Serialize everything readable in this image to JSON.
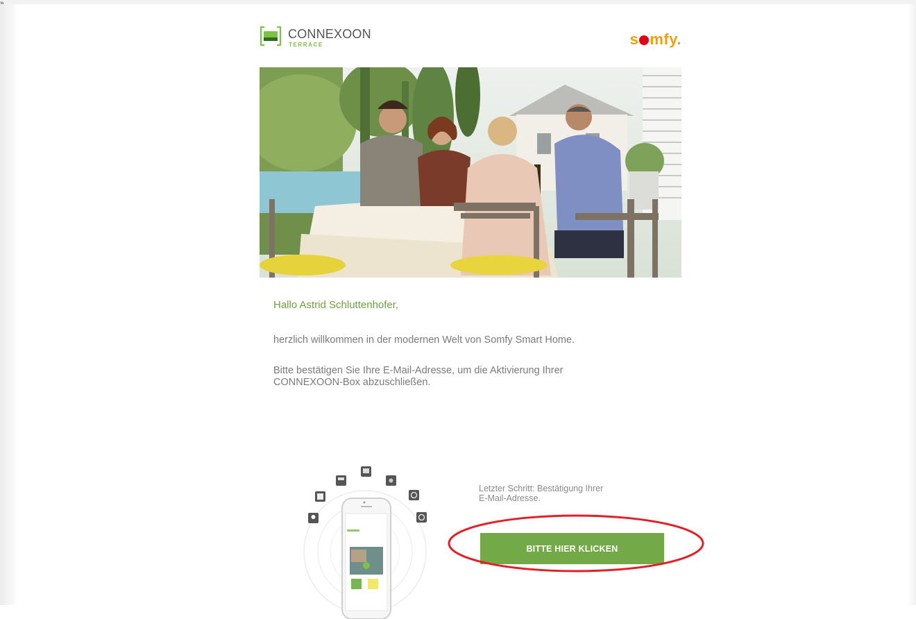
{
  "corner_mark": "»",
  "header": {
    "logo_title": "CONNEXOON",
    "logo_subtitle": "TERRACE",
    "brand": {
      "part1": "s",
      "part2": "mfy",
      "period": ".",
      "color": "#f2a007",
      "dot_color": "#e2001a"
    }
  },
  "hero": {
    "icon": "hero-photo"
  },
  "body": {
    "greeting": "Hallo Astrid Schluttenhofer,",
    "welcome": "herzlich willkommen in der modernen Welt von Somfy Smart Home.",
    "confirm_line1": "Bitte bestätigen Sie Ihre E-Mail-Adresse, um die Aktivierung Ihrer",
    "confirm_line2": "CONNEXOON-Box abzuschließen."
  },
  "cta": {
    "last_step_line1": "Letzter Schritt: Bestätigung Ihrer",
    "last_step_line2": "E-Mail-Adresse.",
    "button_label": "BITTE HIER KLICKEN",
    "button_color": "#74a948",
    "annotation_color": "#e31e24"
  },
  "colors": {
    "accent_green": "#6fa13b",
    "text_gray": "#7a7a7a"
  }
}
